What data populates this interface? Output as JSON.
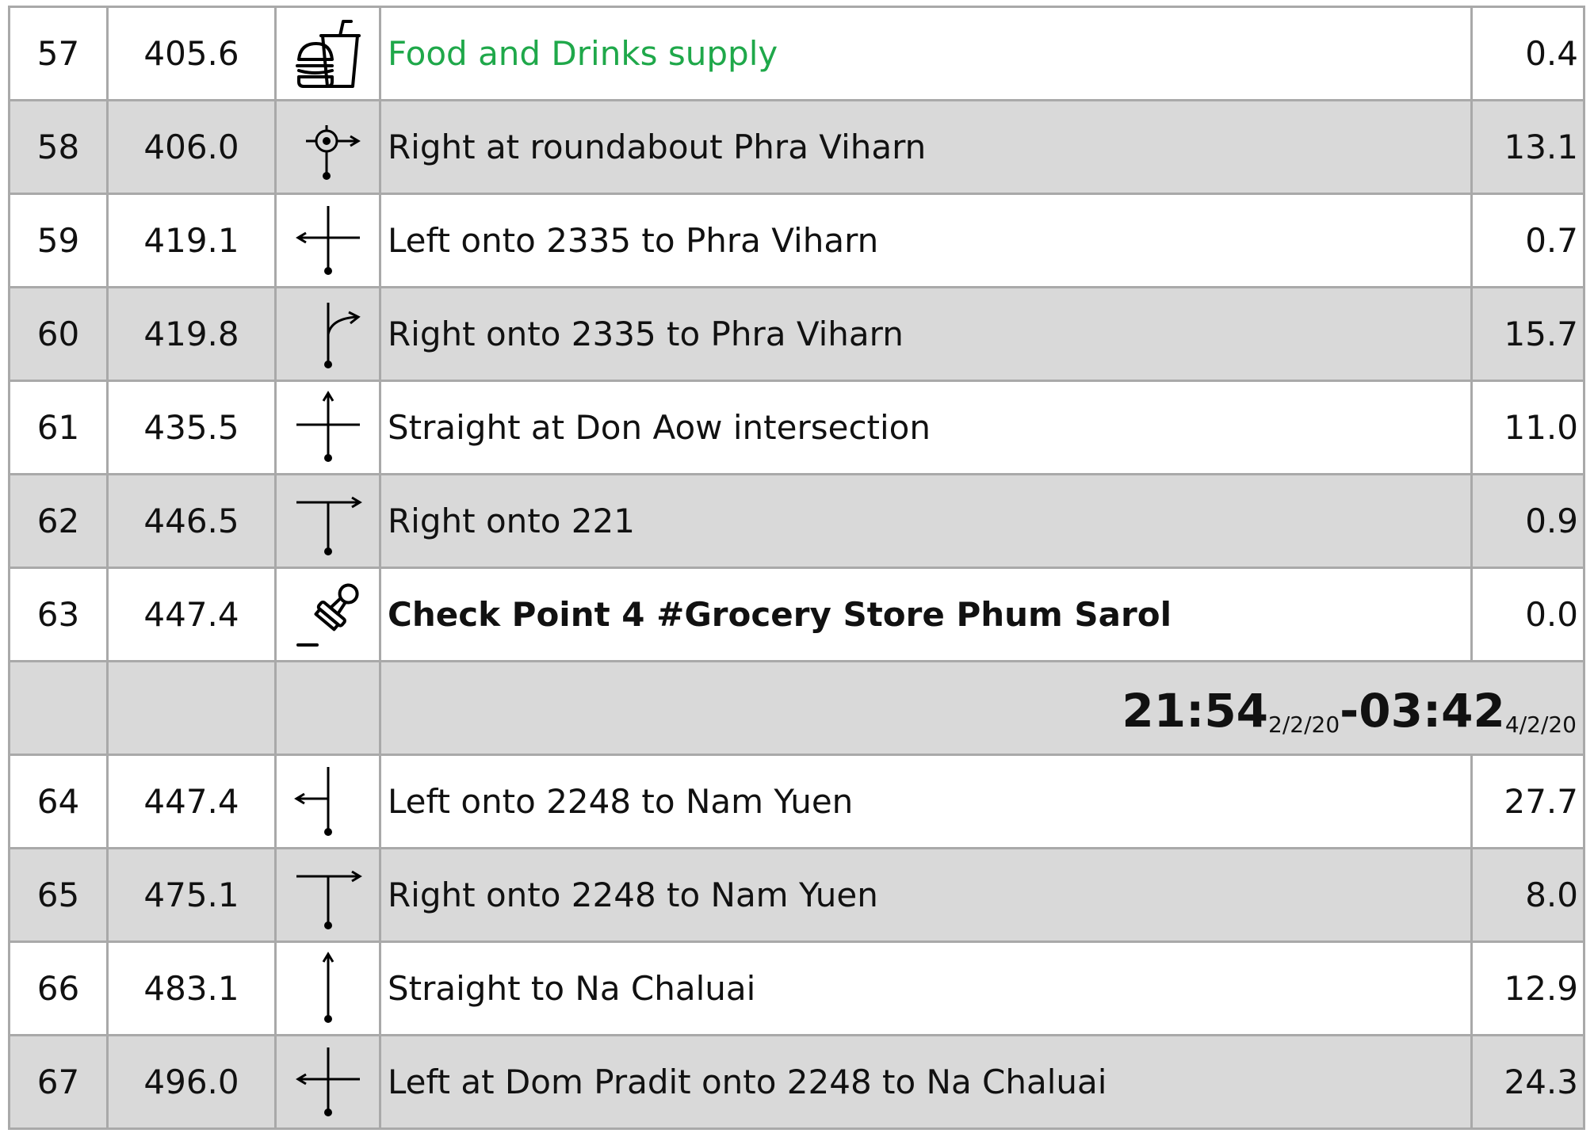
{
  "rows": [
    {
      "num": "57",
      "km": "405.6",
      "icon": "food-drinks-icon",
      "text": "Food and Drinks supply",
      "dist": "0.4",
      "style": "food"
    },
    {
      "num": "58",
      "km": "406.0",
      "icon": "roundabout-right-icon",
      "text": "Right at roundabout Phra Viharn",
      "dist": "13.1",
      "style": "normal"
    },
    {
      "num": "59",
      "km": "419.1",
      "icon": "cross-left-icon",
      "text": "Left onto 2335 to Phra Viharn",
      "dist": "0.7",
      "style": "normal"
    },
    {
      "num": "60",
      "km": "419.8",
      "icon": "bear-right-icon",
      "text": "Right onto 2335 to Phra Viharn",
      "dist": "15.7",
      "style": "normal"
    },
    {
      "num": "61",
      "km": "435.5",
      "icon": "cross-straight-icon",
      "text": "Straight at Don Aow intersection",
      "dist": "11.0",
      "style": "normal"
    },
    {
      "num": "62",
      "km": "446.5",
      "icon": "t-right-icon",
      "text": "Right onto 221",
      "dist": "0.9",
      "style": "normal"
    },
    {
      "num": "63",
      "km": "447.4",
      "icon": "stamp-icon",
      "text": "Check Point 4 #Grocery Store Phum Sarol",
      "dist": "0.0",
      "style": "bold"
    }
  ],
  "checkpoint_time": {
    "open": "21:54",
    "open_date": "2/2/20",
    "separator": "-",
    "close": "03:42",
    "close_date": "4/2/20"
  },
  "rows2": [
    {
      "num": "64",
      "km": "447.4",
      "icon": "left-from-road-icon",
      "text": "Left onto 2248 to Nam Yuen",
      "dist": "27.7",
      "style": "normal"
    },
    {
      "num": "65",
      "km": "475.1",
      "icon": "t-right-icon",
      "text": "Right onto 2248 to Nam Yuen",
      "dist": "8.0",
      "style": "normal"
    },
    {
      "num": "66",
      "km": "483.1",
      "icon": "straight-icon",
      "text": "Straight to Na Chaluai",
      "dist": "12.9",
      "style": "normal"
    },
    {
      "num": "67",
      "km": "496.0",
      "icon": "cross-left-icon",
      "text": "Left at Dom Pradit onto 2248 to Na Chaluai",
      "dist": "24.3",
      "style": "normal"
    }
  ]
}
